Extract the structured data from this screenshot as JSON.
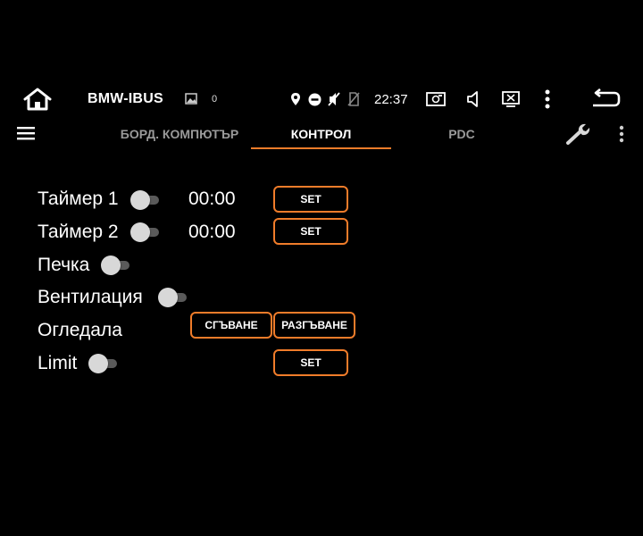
{
  "status_bar": {
    "app_title": "BMW-IBUS",
    "notification_count": "0",
    "time": "22:37"
  },
  "tabs": [
    {
      "label": "БОРД. КОМПЮТЪР",
      "active": false
    },
    {
      "label": "КОНТРОЛ",
      "active": true
    },
    {
      "label": "PDC",
      "active": false
    }
  ],
  "controls": {
    "timer1": {
      "label": "Таймер 1",
      "enabled": false,
      "time": "00:00",
      "button": "SET"
    },
    "timer2": {
      "label": "Таймер 2",
      "enabled": false,
      "time": "00:00",
      "button": "SET"
    },
    "heater": {
      "label": "Печка",
      "enabled": false
    },
    "ventilation": {
      "label": "Вентилация",
      "enabled": false
    },
    "mirrors": {
      "label": "Огледала",
      "fold_button": "СГЪВАНЕ",
      "unfold_button": "РАЗГЪВАНЕ"
    },
    "limit": {
      "label": "Limit",
      "enabled": false,
      "button": "SET"
    }
  },
  "colors": {
    "accent": "#f07c2a",
    "background": "#000000",
    "inactive_tab": "#9a9a9a"
  }
}
